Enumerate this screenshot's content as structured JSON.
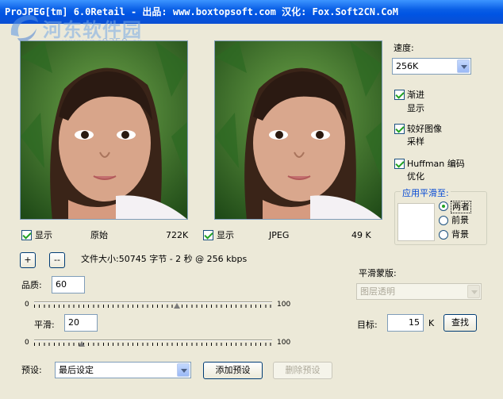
{
  "window": {
    "title": "ProJPEG[tm] 6.0Retail - 出品: www.boxtopsoft.com 汉化: Fox.Soft2CN.CoM"
  },
  "watermark": {
    "name": "河东软件园",
    "url": "www.pc0359.cn"
  },
  "preview_left": {
    "show_label": "显示",
    "caption": "原始",
    "size": "722K",
    "show_checked": true
  },
  "preview_right": {
    "show_label": "显示",
    "caption": "JPEG",
    "size": "49 K",
    "show_checked": true
  },
  "speed": {
    "label": "速度:",
    "value": "256K"
  },
  "options": [
    {
      "line1": "渐进",
      "line2": "显示",
      "checked": true
    },
    {
      "line1": "较好图像",
      "line2": "采样",
      "checked": true
    },
    {
      "line1": "Huffman 编码",
      "line2": "优化",
      "checked": true
    }
  ],
  "smoothing_group": {
    "title": "应用平滑至:",
    "options": [
      "两者",
      "前景",
      "背景"
    ],
    "selected": "两者"
  },
  "zoom": {
    "plus": "+",
    "minus": "--"
  },
  "file_info": "文件大小:50745 字节 - 2 秒 @ 256 kbps",
  "quality": {
    "label": "品质:",
    "value": "60",
    "min": "0",
    "max": "100",
    "level": 60
  },
  "smooth": {
    "label": "平滑:",
    "value": "20",
    "min": "0",
    "max": "100",
    "level": 20
  },
  "smooth_mask": {
    "label": "平滑蒙版:",
    "value": "图层透明"
  },
  "target": {
    "label": "目标:",
    "value": "15",
    "unit": "K",
    "find_button": "查找"
  },
  "preset": {
    "label": "预设:",
    "value": "最后设定",
    "add_button": "添加预设",
    "delete_button": "删除预设"
  }
}
